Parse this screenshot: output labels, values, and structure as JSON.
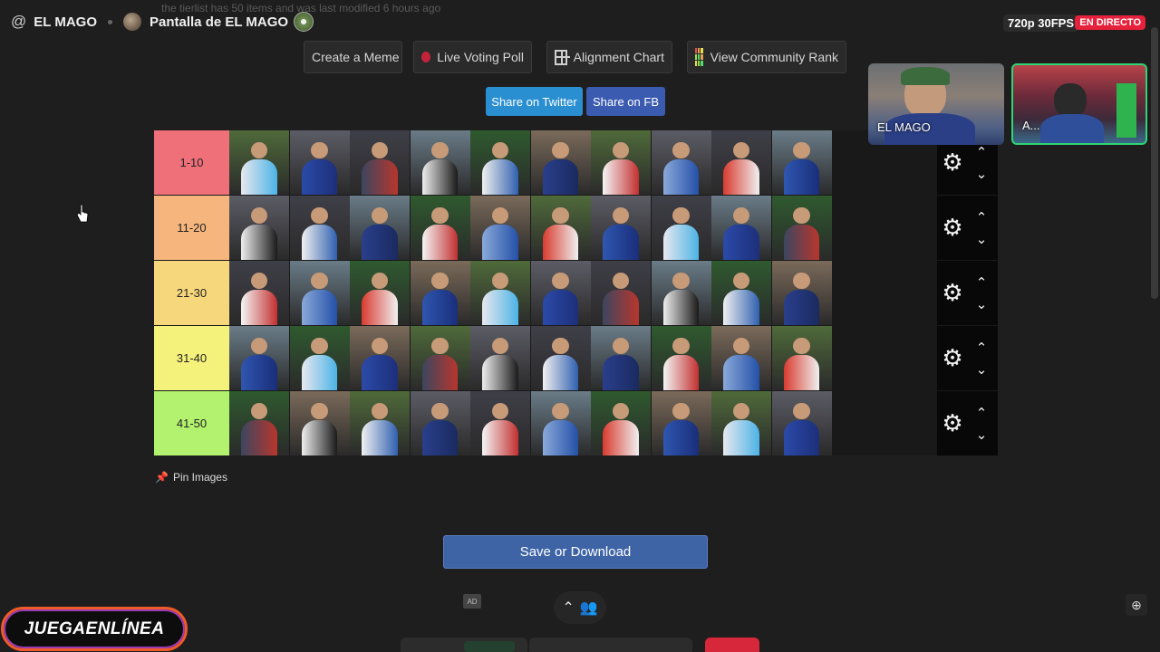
{
  "stream": {
    "at_symbol": "@",
    "channel": "EL MAGO",
    "screen_title": "Pantalla de EL MAGO",
    "ghost_text": "the tierlist has 50 items and was last modified 6 hours ago",
    "quality": "720p 30FPS",
    "live_label": "EN DIRECTO"
  },
  "toolbar": {
    "create_meme": "Create a Meme",
    "live_poll": "Live Voting Poll",
    "alignment_chart": "Alignment Chart",
    "community_rank": "View Community Rank"
  },
  "share": {
    "twitter": "Share on Twitter",
    "fb": "Share on FB"
  },
  "tiers": [
    {
      "label": "1-10",
      "color": "#f0707a"
    },
    {
      "label": "11-20",
      "color": "#f5b57c"
    },
    {
      "label": "21-30",
      "color": "#f7d77c"
    },
    {
      "label": "31-40",
      "color": "#f5f27c"
    },
    {
      "label": "41-50",
      "color": "#b3f26e"
    }
  ],
  "pin_images": "Pin Images",
  "save_download": "Save or Download",
  "webcams": [
    {
      "name": "EL MAGO"
    },
    {
      "name": "A..."
    }
  ],
  "ad_label": "AD",
  "logo_text": "JUEGAENLÍNEA"
}
